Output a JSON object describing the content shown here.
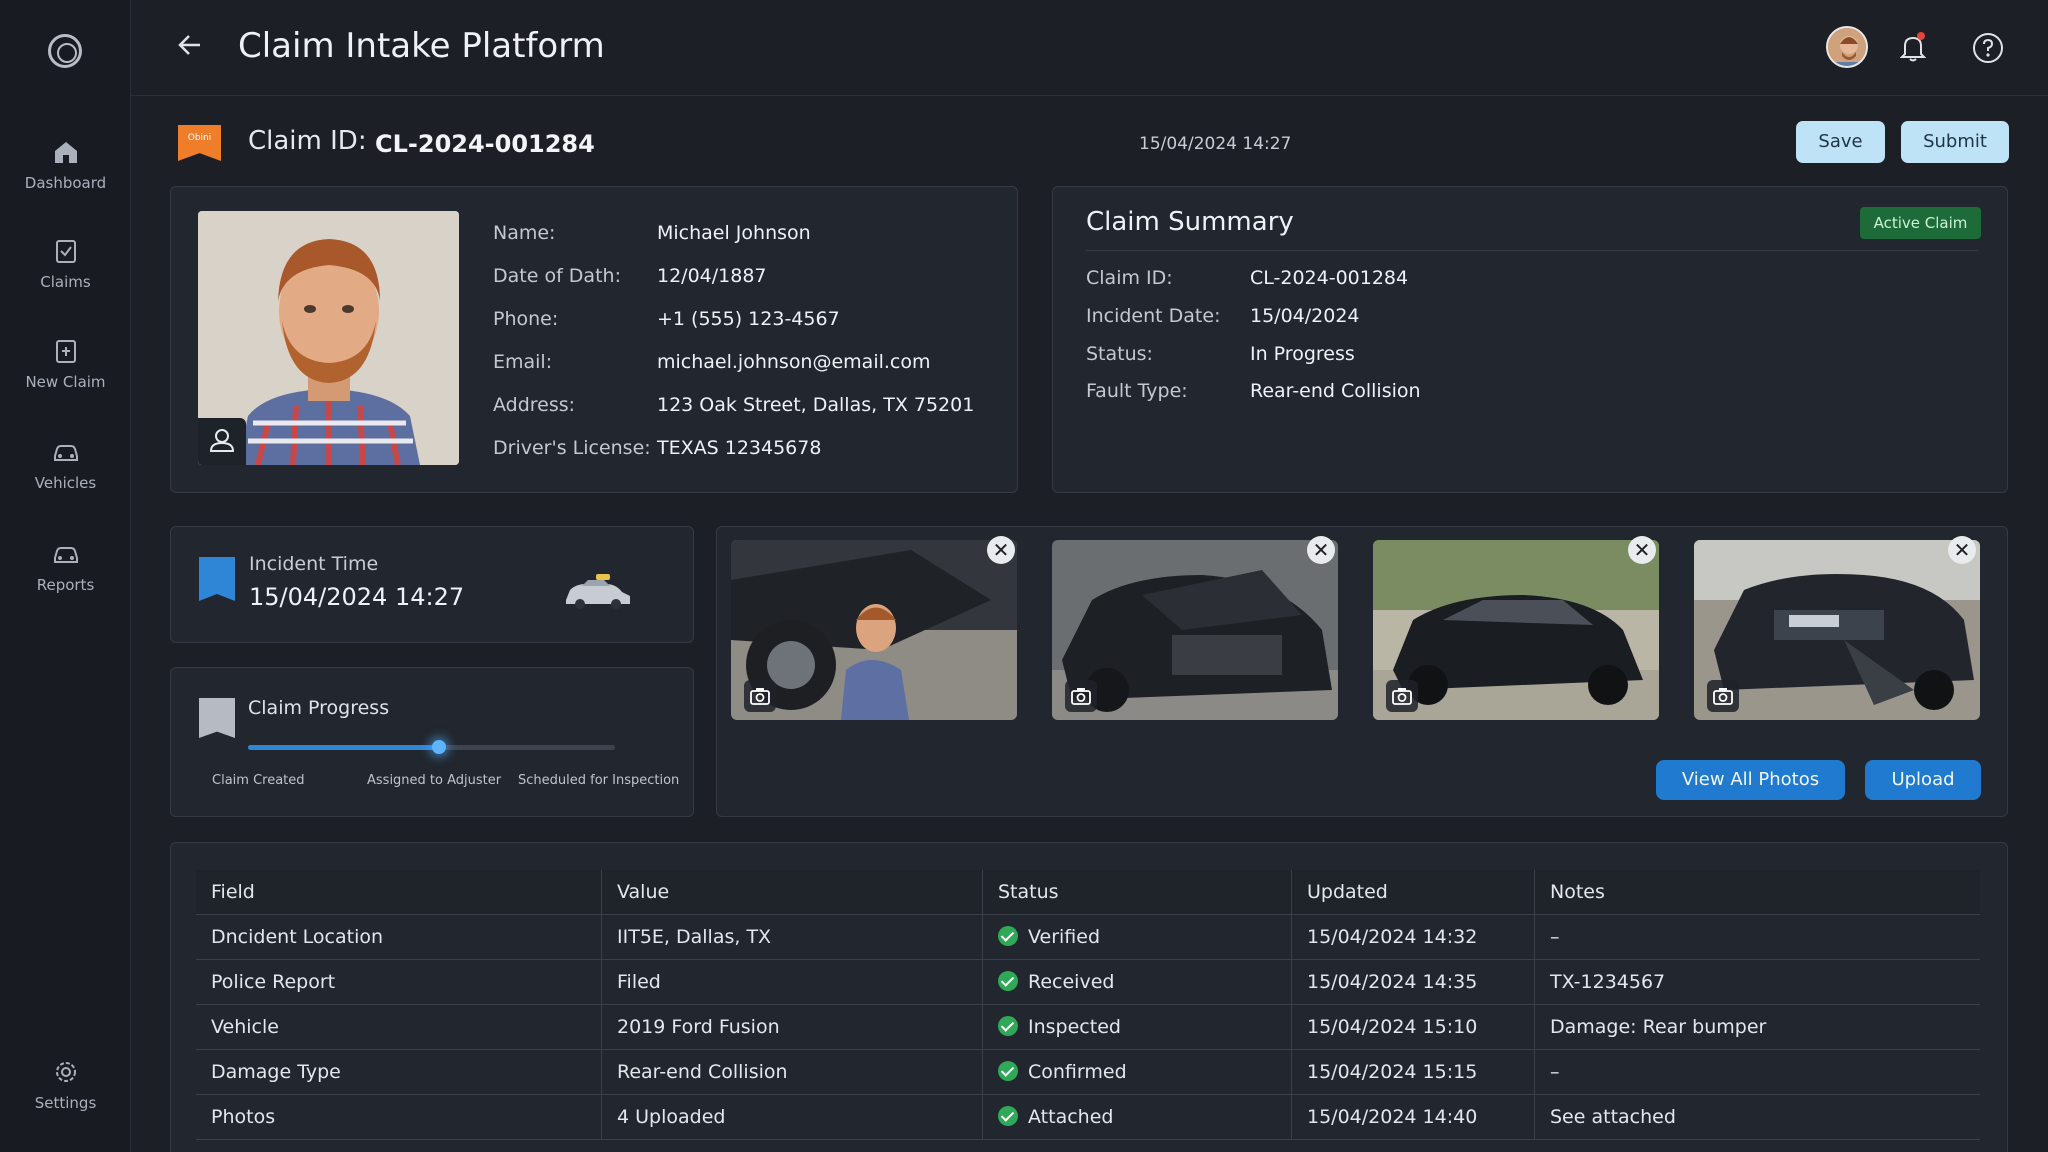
{
  "app": {
    "title": "Claim Intake Platform"
  },
  "sidebar": {
    "items": [
      {
        "label": "Dashboard",
        "icon": "home-icon"
      },
      {
        "label": "Claims",
        "icon": "clipboard-icon"
      },
      {
        "label": "New Claim",
        "icon": "clipboard-plus-icon"
      },
      {
        "label": "Vehicles",
        "icon": "car-icon"
      },
      {
        "label": "Reports",
        "icon": "car-icon"
      },
      {
        "label": "Settings",
        "icon": "gear-icon"
      }
    ]
  },
  "claim_bar": {
    "badge": "Obini",
    "label": "Claim ID:",
    "value": "CL-2024-001284",
    "timestamp": "15/04/2024 14:27",
    "save_label": "Save",
    "submit_label": "Submit"
  },
  "claimant": {
    "fields": [
      {
        "label": "Name:",
        "value": "Michael Johnson"
      },
      {
        "label": "Date of Dath:",
        "value": "12/04/1887"
      },
      {
        "label": "Phone:",
        "value": "+1 (555) 123-4567"
      },
      {
        "label": "Email:",
        "value": "michael.johnson@email.com"
      },
      {
        "label": "Address:",
        "value": "123 Oak Street, Dallas, TX 75201"
      },
      {
        "label": "Driver's License:",
        "value": "TEXAS 12345678"
      }
    ]
  },
  "summary": {
    "title": "Claim Summary",
    "badge": "Active Claim",
    "fields": [
      {
        "label": "Claim ID:",
        "value": "CL-2024-001284"
      },
      {
        "label": "Incident Date:",
        "value": "15/04/2024"
      },
      {
        "label": "Status:",
        "value": "In Progress"
      },
      {
        "label": "Fault Type:",
        "value": "Rear-end Collision"
      }
    ]
  },
  "incident": {
    "title": "Incident Time",
    "value": "15/04/2024 14:27"
  },
  "progress": {
    "title": "Claim Progress",
    "fraction": 0.52,
    "steps": [
      "Claim Created",
      "Assigned to Adjuster",
      "Scheduled for Inspection"
    ]
  },
  "photos": {
    "view_all_label": "View All Photos",
    "upload_label": "Upload",
    "close_glyph": "✕"
  },
  "table": {
    "headers": [
      "Field",
      "Value",
      "Status",
      "Updated",
      "Notes"
    ],
    "rows": [
      [
        "Dncident Location",
        "IIT5E, Dallas, TX",
        "Verified",
        "15/04/2024 14:32",
        "–"
      ],
      [
        "Police Report",
        "Filed",
        "Received",
        "15/04/2024 14:35",
        "TX-1234567"
      ],
      [
        "Vehicle",
        "2019 Ford Fusion",
        "Inspected",
        "15/04/2024 15:10",
        "Damage: Rear bumper"
      ],
      [
        "Damage Type",
        "Rear-end Collision",
        "Confirmed",
        "15/04/2024 15:15",
        "–"
      ],
      [
        "Photos",
        "4 Uploaded",
        "Attached",
        "15/04/2024 14:40",
        "See attached"
      ]
    ]
  },
  "colors": {
    "accent": "#1f7ad0",
    "success": "#2fa857",
    "badge_orange": "#ef7d2a",
    "light_button": "#bfe3f6"
  }
}
